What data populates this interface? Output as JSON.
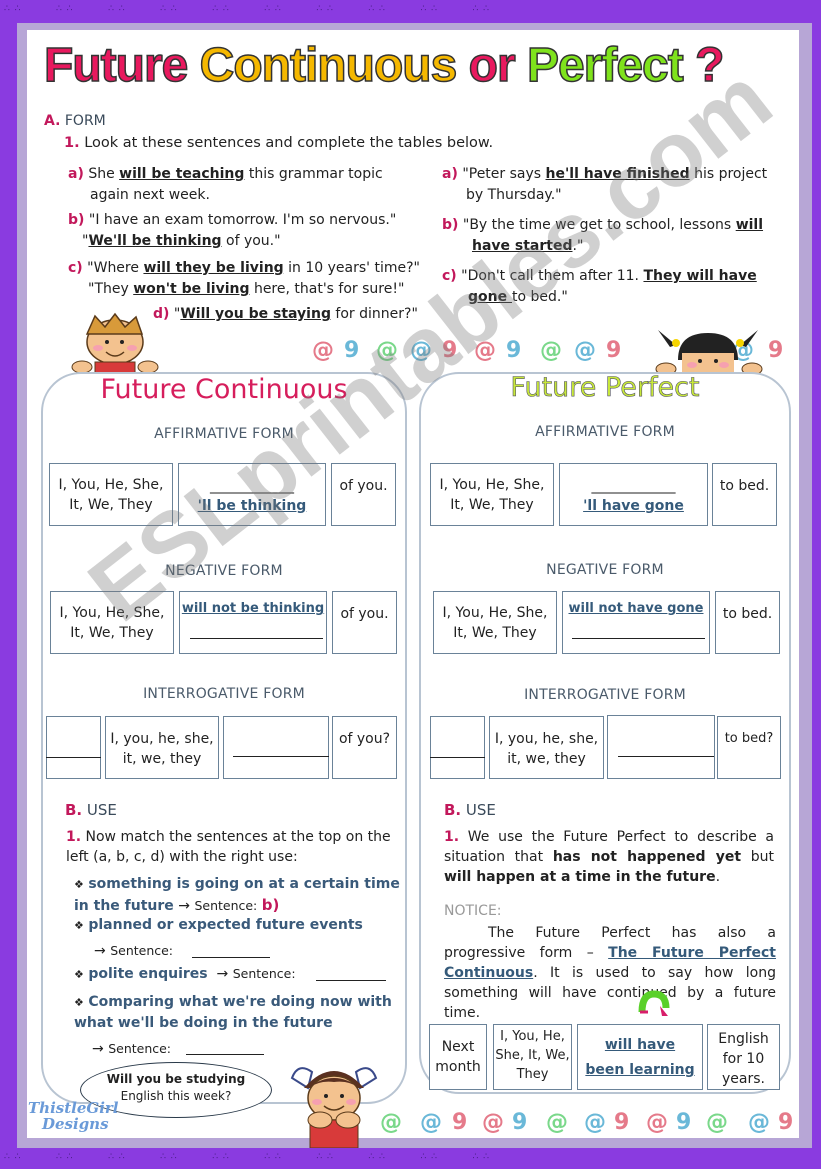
{
  "title": {
    "word1": "Future",
    "word2": "Continuous",
    "word3": "or",
    "word4": "Perfect",
    "word5": "?"
  },
  "section_a": {
    "letter": "A.",
    "heading": "FORM",
    "instr_num": "1.",
    "instruction": "Look at these sentences and complete the tables below."
  },
  "left_sentences": {
    "a": {
      "label": "a)",
      "pre": "She ",
      "bold": "will be teaching",
      "post": " this grammar topic",
      "line2": "again next week."
    },
    "b": {
      "label": "b)",
      "line1": "\"I have an exam tomorrow. I'm so nervous.\"",
      "pre2": "\"",
      "bold": "We'll be thinking",
      "post2": " of you.\""
    },
    "c": {
      "label": "c)",
      "pre": "\"Where ",
      "bold": "will they be living",
      "post": " in 10 years' time?\"",
      "pre2": "\"They ",
      "bold2": "won't be living",
      "post2": " here, that's for sure!\""
    },
    "d": {
      "label": "d)",
      "pre": "\"",
      "bold": "Will you be staying",
      "post": " for dinner?\""
    }
  },
  "right_sentences": {
    "a": {
      "label": "a)",
      "pre": "\"Peter says ",
      "bold": "he'll have finished",
      "post": " his project",
      "line2": "by Thursday.\""
    },
    "b": {
      "label": "b)",
      "pre": "\"By the time we get to school, lessons ",
      "bold": "will",
      "bold2": "have started",
      "post2": ".\""
    },
    "c": {
      "label": "c)",
      "pre": "\"Don't call them after 11. ",
      "bold": "They will have",
      "bold2": "gone ",
      "post2": "to bed.\""
    }
  },
  "continuous": {
    "title": "Future Continuous",
    "affirmative": {
      "label": "AFFIRMATIVE FORM",
      "subject": "I, You, He, She, It, We, They",
      "blank": "____________",
      "answer": "'ll be thinking",
      "end": "of you."
    },
    "negative": {
      "label": "NEGATIVE FORM",
      "subject": "I, You, He, She, It, We, They",
      "answer": "will not be thinking",
      "end": "of you."
    },
    "interrogative": {
      "label": "INTERROGATIVE FORM",
      "subject": "I, you, he, she, it, we, they",
      "end": "of you?"
    }
  },
  "perfect": {
    "title": "Future Perfect",
    "affirmative": {
      "label": "AFFIRMATIVE FORM",
      "subject": "I, You, He, She, It, We, They",
      "blank": "____________",
      "answer": "'ll have gone",
      "end": "to bed."
    },
    "negative": {
      "label": "NEGATIVE FORM",
      "subject": "I, You, He, She, It, We, They",
      "answer": "will not have gone",
      "end": "to bed."
    },
    "interrogative": {
      "label": "INTERROGATIVE FORM",
      "subject": "I, you, he, she, it, we, they",
      "end": "to bed?"
    }
  },
  "use_left": {
    "letter": "B.",
    "heading": "USE",
    "num": "1.",
    "instruction": "Now match the sentences at the top on the left (a, b, c, d) with the right use:",
    "items": [
      {
        "text": "something is going on at a certain time in the future",
        "sentence_label": "Sentence:",
        "answer": "b)"
      },
      {
        "text": "planned or expected future events",
        "sentence_label": "Sentence:",
        "answer": ""
      },
      {
        "text": "polite enquires",
        "sentence_label": "Sentence:",
        "answer": ""
      },
      {
        "text": "Comparing what we're doing now with what we'll be doing in the future",
        "sentence_label": "Sentence:",
        "answer": ""
      }
    ],
    "arrow": "→",
    "bullet": "❖"
  },
  "use_right": {
    "letter": "B.",
    "heading": "USE",
    "num": "1.",
    "p1": "We use the Future Perfect to describe a situation that ",
    "p1_bold1": "has not happened yet",
    "p1_mid": " but ",
    "p1_bold2": "will happen at a time in the future",
    "p1_end": ".",
    "notice_label": "NOTICE:",
    "notice_pre": "The Future Perfect has also a progressive form – ",
    "notice_link": "The Future Perfect Continuous",
    "notice_post": ". It is used to say how long something will have continued by a future time."
  },
  "example_row": {
    "time": "Next month",
    "subject": "I, You, He, She, It, We, They",
    "verb1": "will have",
    "verb2": "been learning",
    "end": "English for 10 years."
  },
  "bubble": {
    "bold": "Will you be studying",
    "text": "English this week?"
  },
  "logo": {
    "line1": "ThistleGirl",
    "line2": "Designs"
  },
  "watermark": "ESLprintables.com"
}
